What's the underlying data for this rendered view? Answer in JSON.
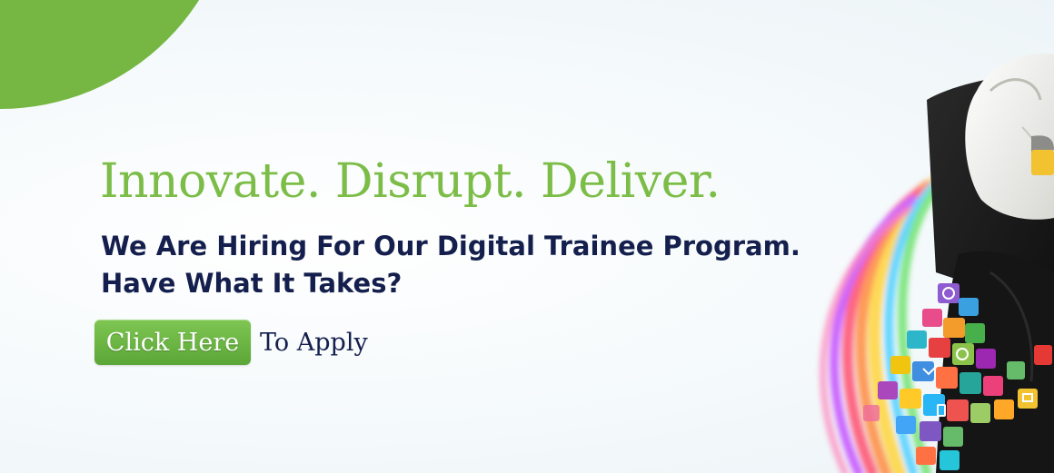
{
  "banner": {
    "headline": "Innovate. Disrupt. Deliver.",
    "subhead_line1": "We Are Hiring For Our Digital Trainee Program.",
    "subhead_line2": "Have What It Takes?",
    "cta_label": "Click Here",
    "cta_suffix": "To Apply"
  },
  "colors": {
    "accent_green": "#76b743",
    "headline_green": "#7cbd47",
    "navy_text": "#141f4d",
    "background": "#f6fafc"
  },
  "decoration": {
    "hero_image": "person-carrying-app-icon-cubes-illustration",
    "icons": [
      "info-icon",
      "globe-icon",
      "mail-icon",
      "check-icon",
      "phone-icon"
    ]
  }
}
